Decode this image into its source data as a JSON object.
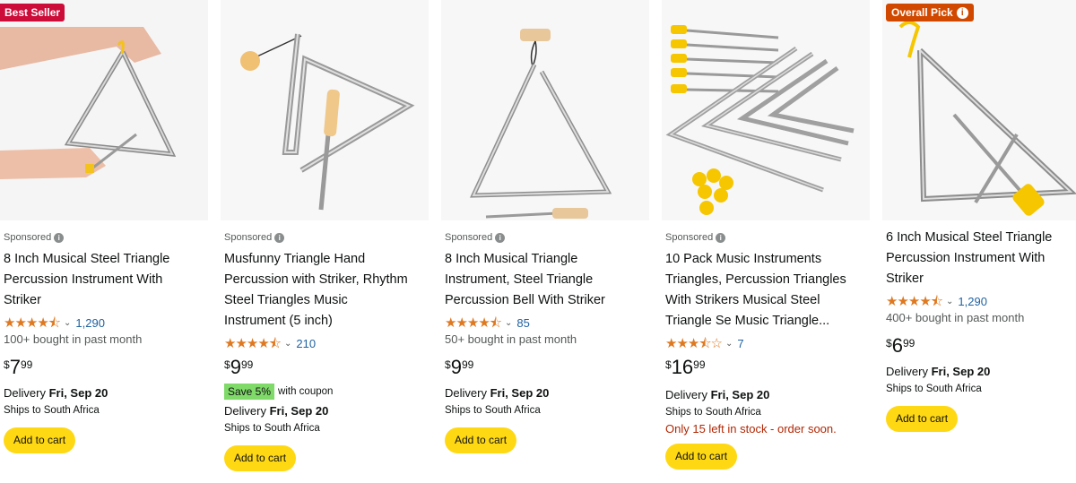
{
  "products": [
    {
      "badge": "Best Seller",
      "sponsored": "Sponsored",
      "title_lines": [
        "8 Inch Musical Steel Triangle",
        "Percussion Instrument With",
        "Striker"
      ],
      "stars": "★★★★⯪",
      "rating_count": "1,290",
      "bought": "100+ bought in past month",
      "price": {
        "currency": "$",
        "whole": "7",
        "fraction": "99"
      },
      "delivery_label": "Delivery",
      "delivery_date": "Fri, Sep 20",
      "ships": "Ships to South Africa",
      "button": "Add to cart"
    },
    {
      "sponsored": "Sponsored",
      "title_lines": [
        "Musfunny Triangle Hand",
        "Percussion with Striker, Rhythm",
        "Steel Triangles Music",
        "Instrument (5 inch)"
      ],
      "stars": "★★★★⯪",
      "rating_count": "210",
      "price": {
        "currency": "$",
        "whole": "9",
        "fraction": "99"
      },
      "coupon_badge": "Save 5%",
      "coupon_text": "with coupon",
      "delivery_label": "Delivery",
      "delivery_date": "Fri, Sep 20",
      "ships": "Ships to South Africa",
      "button": "Add to cart"
    },
    {
      "sponsored": "Sponsored",
      "title_lines": [
        "8 Inch Musical Triangle",
        "Instrument, Steel Triangle",
        "Percussion Bell With Striker"
      ],
      "stars": "★★★★⯪",
      "rating_count": "85",
      "bought": "50+ bought in past month",
      "price": {
        "currency": "$",
        "whole": "9",
        "fraction": "99"
      },
      "delivery_label": "Delivery",
      "delivery_date": "Fri, Sep 20",
      "ships": "Ships to South Africa",
      "button": "Add to cart"
    },
    {
      "sponsored": "Sponsored",
      "title_lines": [
        "10 Pack Music Instruments",
        "Triangles, Percussion Triangles",
        "With Strikers Musical Steel",
        "Triangle Se Music Triangle..."
      ],
      "stars": "★★★⯪☆",
      "rating_count": "7",
      "price": {
        "currency": "$",
        "whole": "16",
        "fraction": "99"
      },
      "delivery_label": "Delivery",
      "delivery_date": "Fri, Sep 20",
      "ships": "Ships to South Africa",
      "stock": "Only 15 left in stock - order soon.",
      "button": "Add to cart"
    },
    {
      "badge": "Overall Pick",
      "title_lines": [
        "6 Inch Musical Steel Triangle",
        "Percussion Instrument With",
        "Striker"
      ],
      "stars": "★★★★⯪",
      "rating_count": "1,290",
      "bought": "400+ bought in past month",
      "price": {
        "currency": "$",
        "whole": "6",
        "fraction": "99"
      },
      "delivery_label": "Delivery",
      "delivery_date": "Fri, Sep 20",
      "ships": "Ships to South Africa",
      "button": "Add to cart"
    }
  ],
  "colors": {
    "accent_button": "#ffd814",
    "star": "#de7921",
    "link": "#2162a1",
    "best_seller": "#cc0c39",
    "overall_pick": "#d14900",
    "coupon": "#7fda69",
    "stock_warning": "#b12704"
  },
  "icons": {
    "info": "info-icon",
    "chevron": "chevron-down-icon"
  }
}
